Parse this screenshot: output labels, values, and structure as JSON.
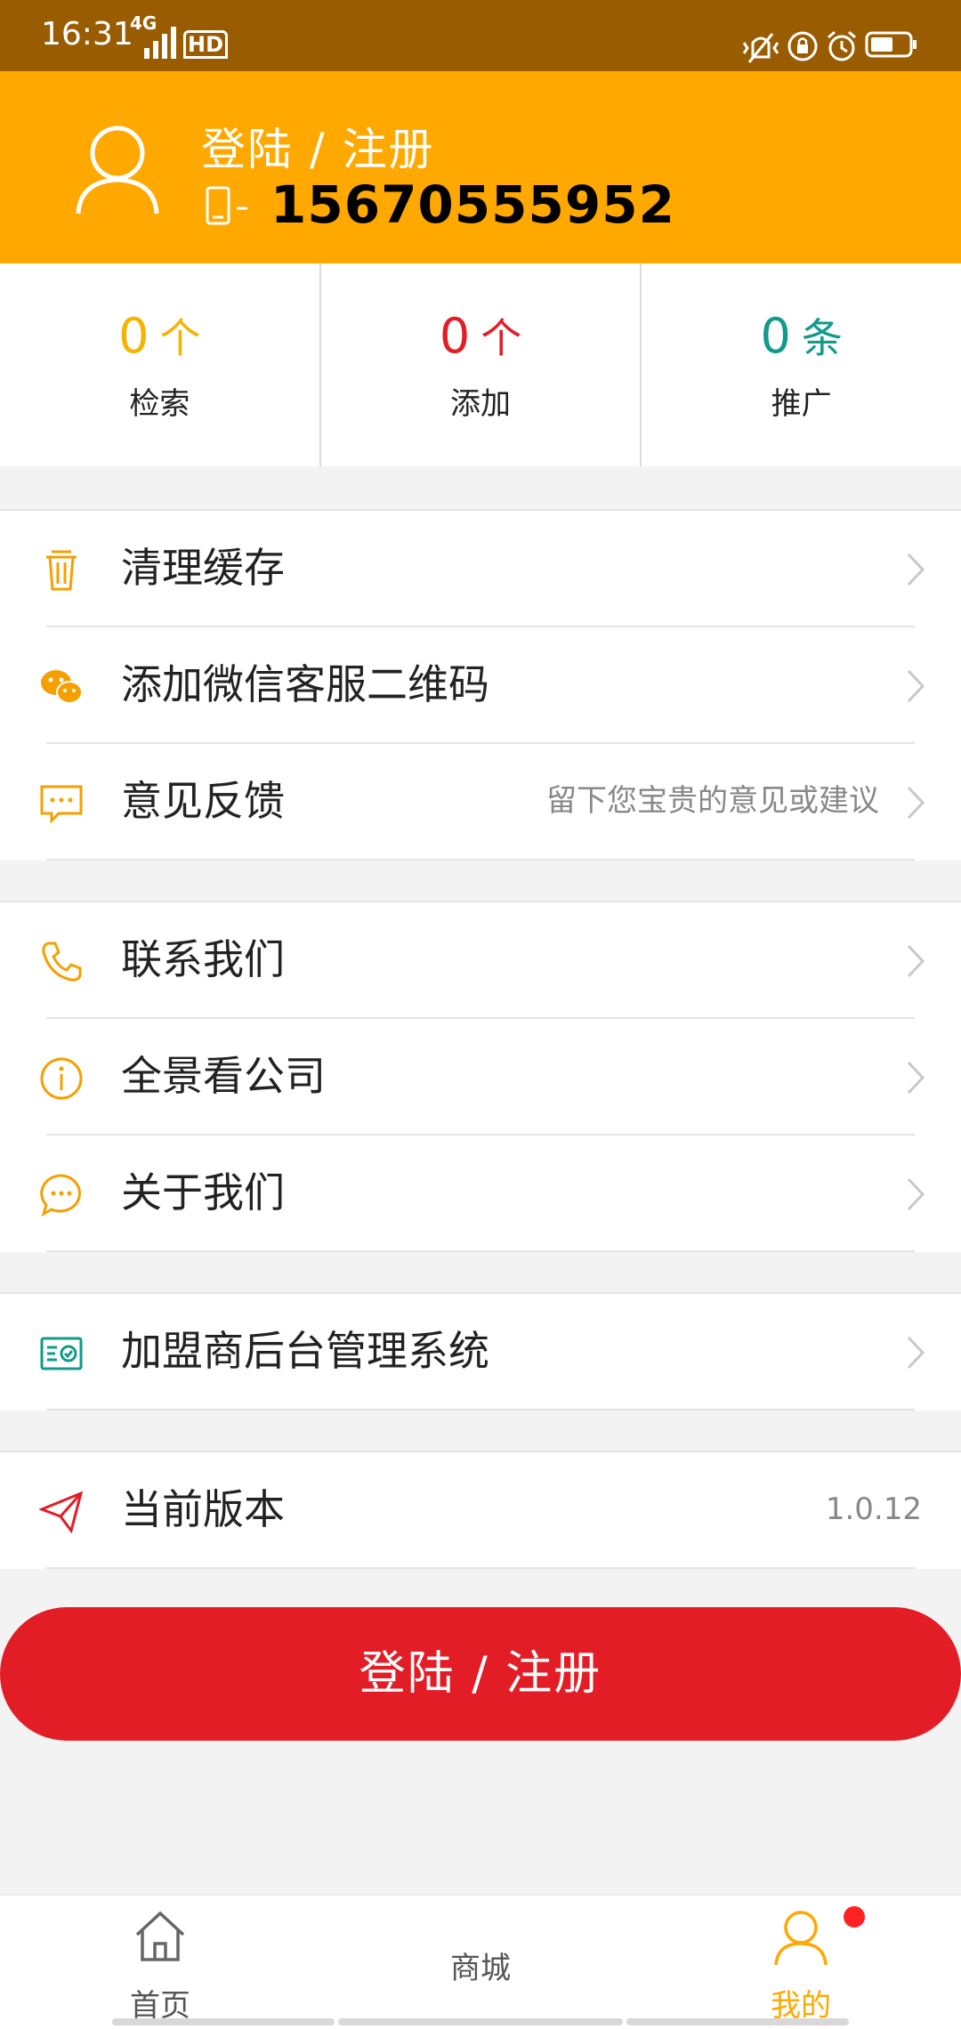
{
  "status_bar": {
    "time": "16:31",
    "network": "4G",
    "hd": "HD"
  },
  "header": {
    "login_text": "登陆 / 注册",
    "phone": "15670555952"
  },
  "stats": [
    {
      "value": "0",
      "unit": "个",
      "label": "检索",
      "color": "#f5b400"
    },
    {
      "value": "0",
      "unit": "个",
      "label": "添加",
      "color": "#e31d26"
    },
    {
      "value": "0",
      "unit": "条",
      "label": "推广",
      "color": "#129a8a"
    }
  ],
  "menu": {
    "group1": [
      {
        "label": "清理缓存",
        "icon": "trash-icon"
      },
      {
        "label": "添加微信客服二维码",
        "icon": "wechat-icon"
      },
      {
        "label": "意见反馈",
        "icon": "feedback-icon",
        "hint": "留下您宝贵的意见或建议"
      }
    ],
    "group2": [
      {
        "label": "联系我们",
        "icon": "phone-icon"
      },
      {
        "label": "全景看公司",
        "icon": "info-icon"
      },
      {
        "label": "关于我们",
        "icon": "chat-icon"
      }
    ],
    "group3": [
      {
        "label": "加盟商后台管理系统",
        "icon": "admin-card-icon"
      }
    ],
    "group4": [
      {
        "label": "当前版本",
        "icon": "send-icon",
        "value": "1.0.12"
      }
    ]
  },
  "login_button": "登陆 / 注册",
  "tabbar": {
    "home": "首页",
    "mall": "商城",
    "mine": "我的"
  },
  "colors": {
    "accent": "#ffa800",
    "brand_red": "#e31d26",
    "teal": "#129a8a",
    "status_bar": "#9a5c00"
  }
}
